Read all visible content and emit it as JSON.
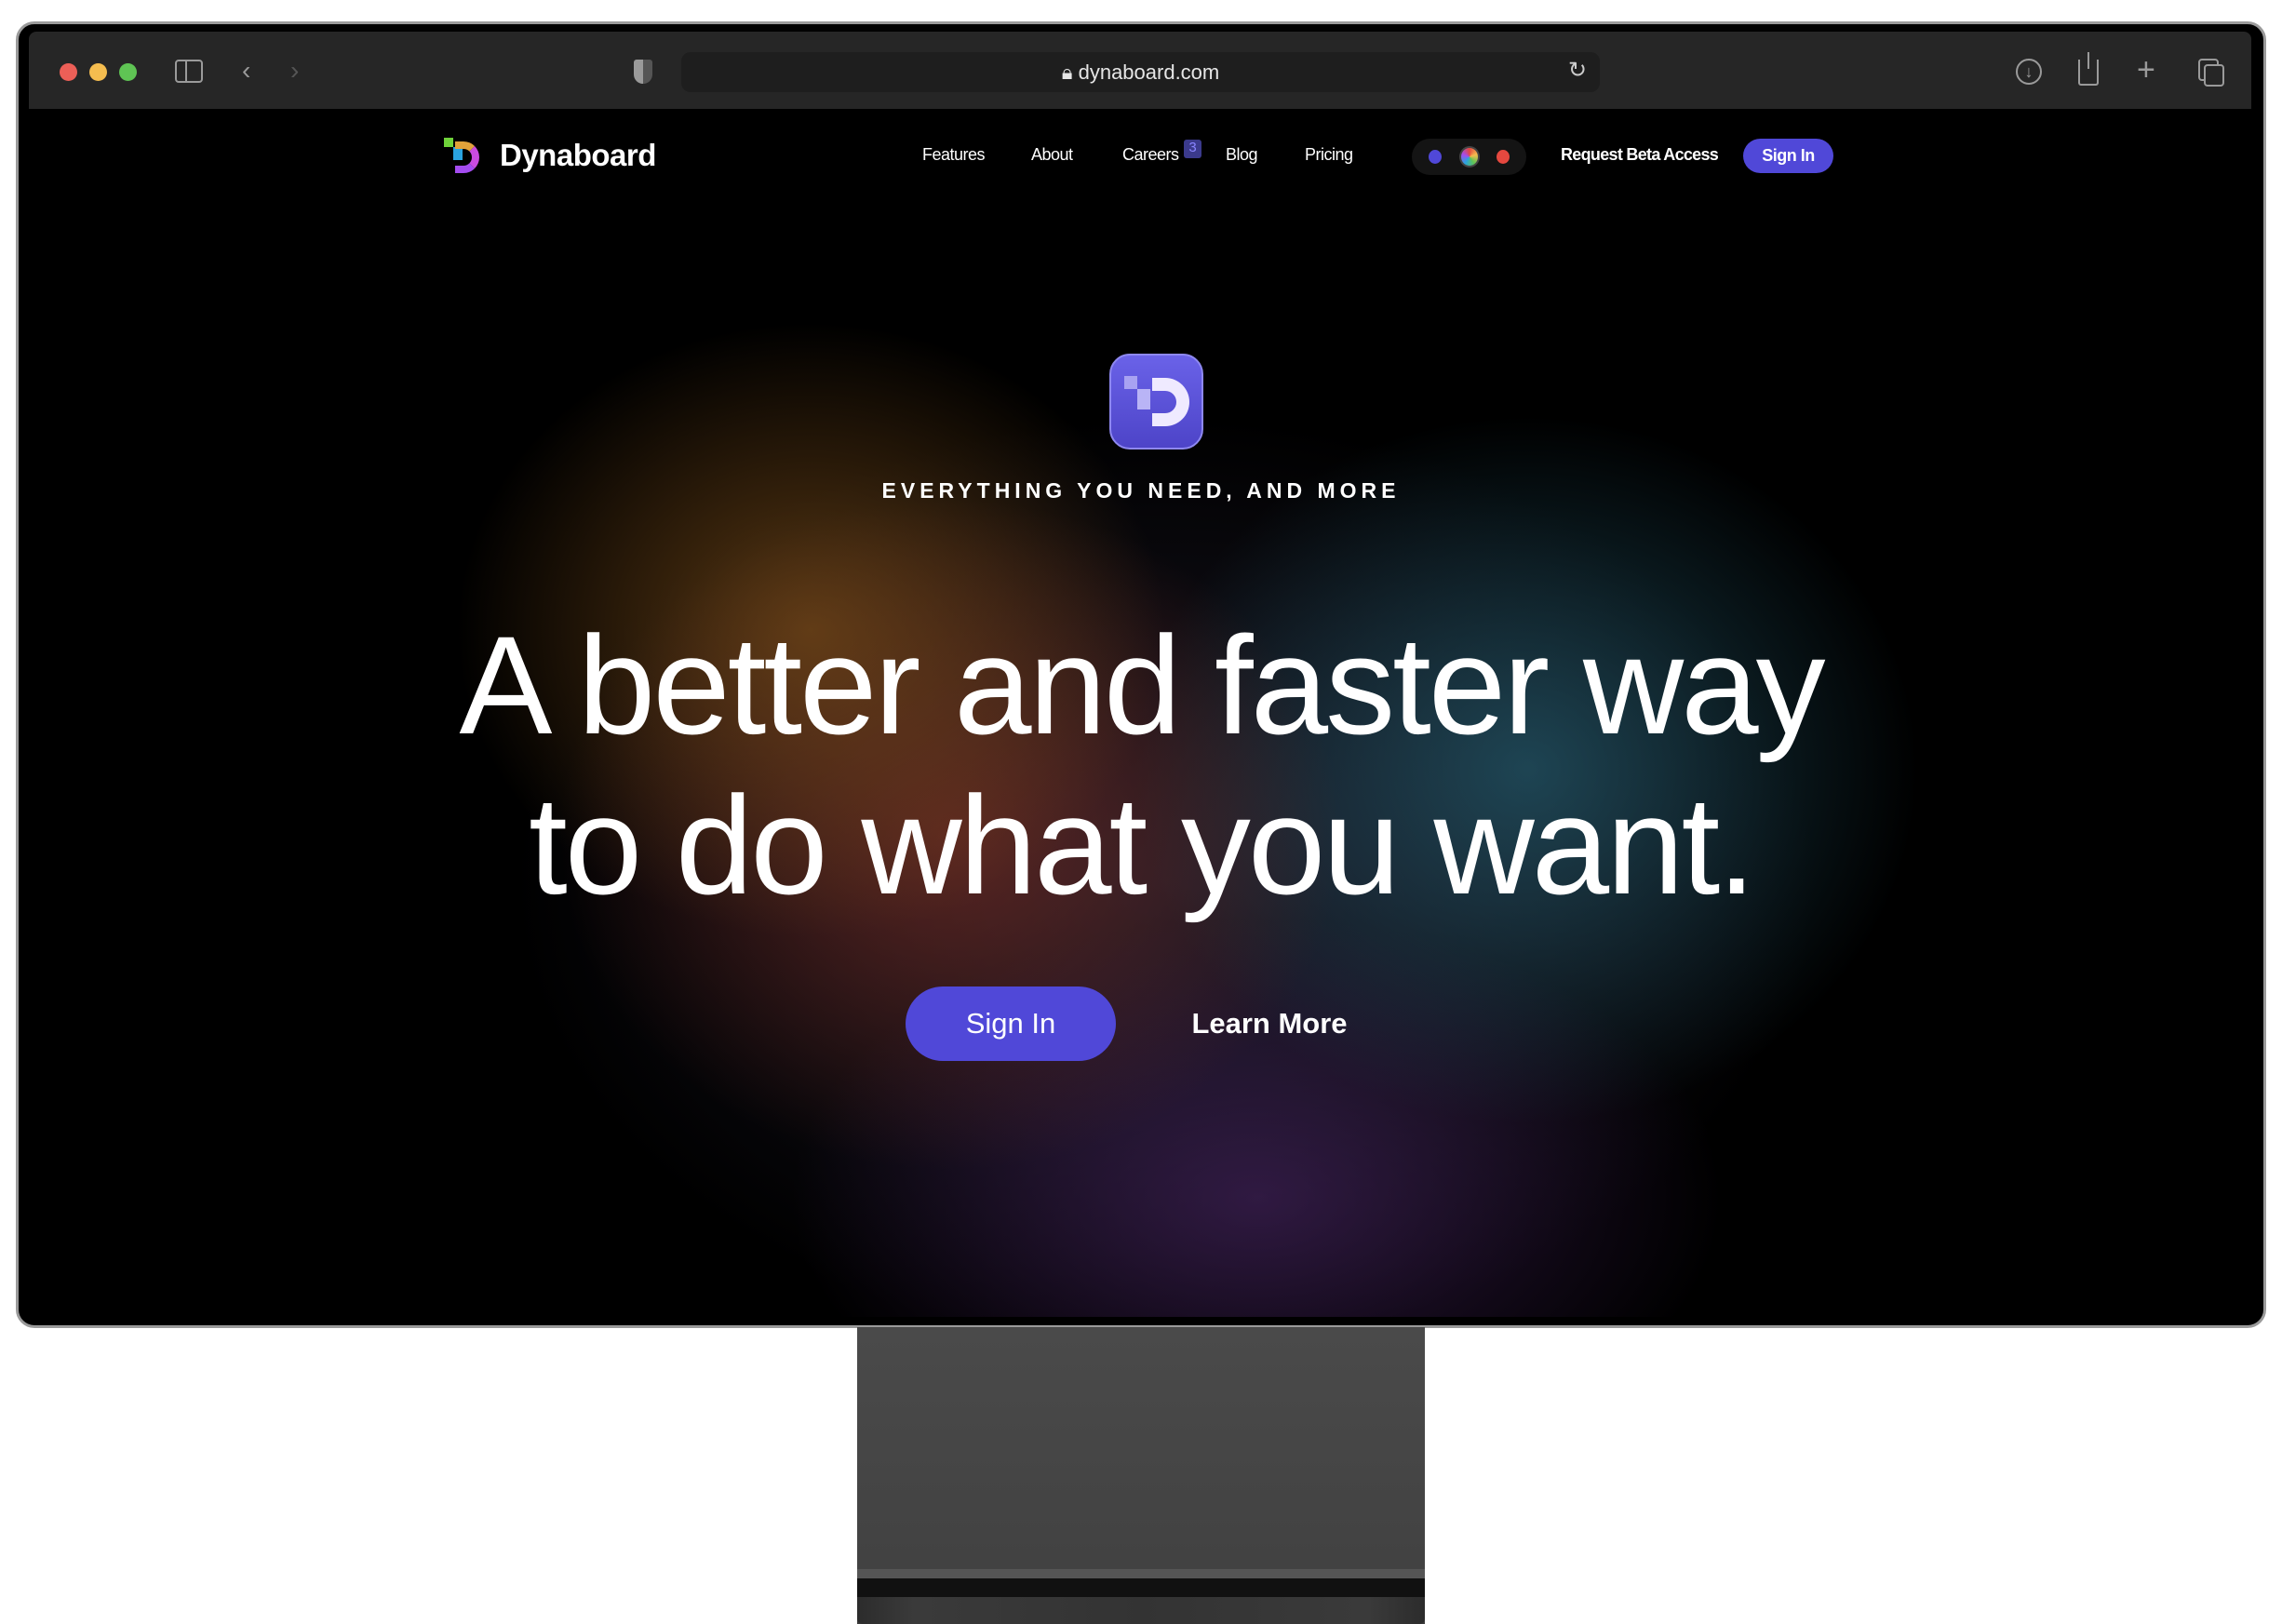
{
  "browser": {
    "url": "dynaboard.com",
    "traffic_lights": [
      "#ec5f57",
      "#f5bd4f",
      "#5fc454"
    ]
  },
  "nav": {
    "brand": "Dynaboard",
    "links": [
      {
        "label": "Features"
      },
      {
        "label": "About"
      },
      {
        "label": "Careers",
        "badge": "3"
      },
      {
        "label": "Blog"
      },
      {
        "label": "Pricing"
      }
    ],
    "theme_colors": [
      "#5048d8",
      "conic",
      "#e5483f"
    ],
    "cta": "Request Beta Access",
    "sign_in": "Sign In"
  },
  "hero": {
    "eyebrow": "EVERYTHING YOU NEED, AND MORE",
    "headline_line1": "A better and faster way",
    "headline_line2": "to do what you want.",
    "primary_button": "Sign In",
    "secondary_button": "Learn More"
  },
  "colors": {
    "accent": "#5048d8",
    "toolbar": "#262626"
  }
}
